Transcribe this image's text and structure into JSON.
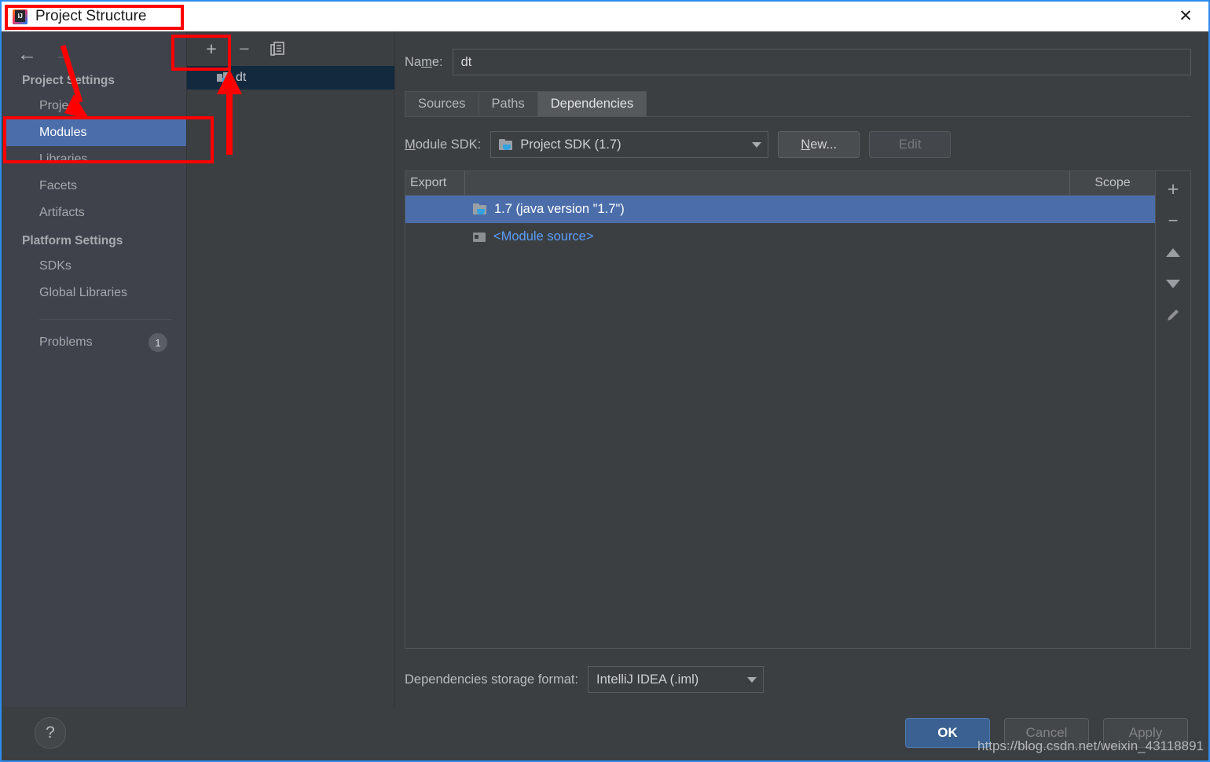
{
  "window": {
    "title": "Project Structure",
    "logo_icon": "intellij-idea-logo",
    "close_icon": "✕"
  },
  "nav": {
    "back_icon": "←",
    "forward_icon": "→",
    "groups": [
      {
        "title": "Project Settings",
        "items": [
          {
            "label": "Project",
            "selected": false
          },
          {
            "label": "Modules",
            "selected": true
          },
          {
            "label": "Libraries",
            "selected": false
          },
          {
            "label": "Facets",
            "selected": false
          },
          {
            "label": "Artifacts",
            "selected": false
          }
        ]
      },
      {
        "title": "Platform Settings",
        "items": [
          {
            "label": "SDKs",
            "selected": false
          },
          {
            "label": "Global Libraries",
            "selected": false
          }
        ]
      }
    ],
    "problems": {
      "label": "Problems",
      "count": "1"
    }
  },
  "tree": {
    "toolbar": {
      "add_icon": "+",
      "remove_icon": "−",
      "copy_icon": "copy-icon"
    },
    "modules": [
      {
        "label": "dt",
        "selected": true
      }
    ]
  },
  "module": {
    "name_label": "Name:",
    "name_value": "dt",
    "tabs": [
      {
        "label": "Sources",
        "active": false
      },
      {
        "label": "Paths",
        "active": false
      },
      {
        "label": "Dependencies",
        "active": true
      }
    ],
    "sdk_label": "Module SDK:",
    "sdk_value": "Project SDK (1.7)",
    "new_button": "New...",
    "edit_button": "Edit",
    "table": {
      "columns": [
        "Export",
        "",
        "Scope"
      ],
      "rows": [
        {
          "export": "",
          "name": "1.7 (java version \"1.7\")",
          "scope": "",
          "selected": true,
          "link": false
        },
        {
          "export": "",
          "name": "<Module source>",
          "scope": "",
          "selected": false,
          "link": true
        }
      ],
      "side_buttons": [
        {
          "icon": "plus-icon",
          "name": "add"
        },
        {
          "icon": "minus-icon",
          "name": "remove"
        },
        {
          "icon": "arrow-up-icon",
          "name": "move-up"
        },
        {
          "icon": "arrow-down-icon",
          "name": "move-down"
        },
        {
          "icon": "pencil-icon",
          "name": "edit"
        }
      ]
    },
    "storage_label": "Dependencies storage format:",
    "storage_value": "IntelliJ IDEA (.iml)"
  },
  "footer": {
    "help_icon": "?",
    "ok": "OK",
    "cancel": "Cancel",
    "apply": "Apply"
  },
  "watermark": "https://blog.csdn.net/weixin_43118891",
  "colors": {
    "window_border": "#2d8cf0",
    "titlebar_bg": "#ffffff",
    "panel_bg": "#3c3f41",
    "sidebar_bg": "#3f424b",
    "selection_blue": "#4b6eab",
    "tree_selection": "#13293d",
    "link_blue": "#599eff",
    "annotation_red": "#fe0000",
    "primary_button": "#3a6191"
  }
}
